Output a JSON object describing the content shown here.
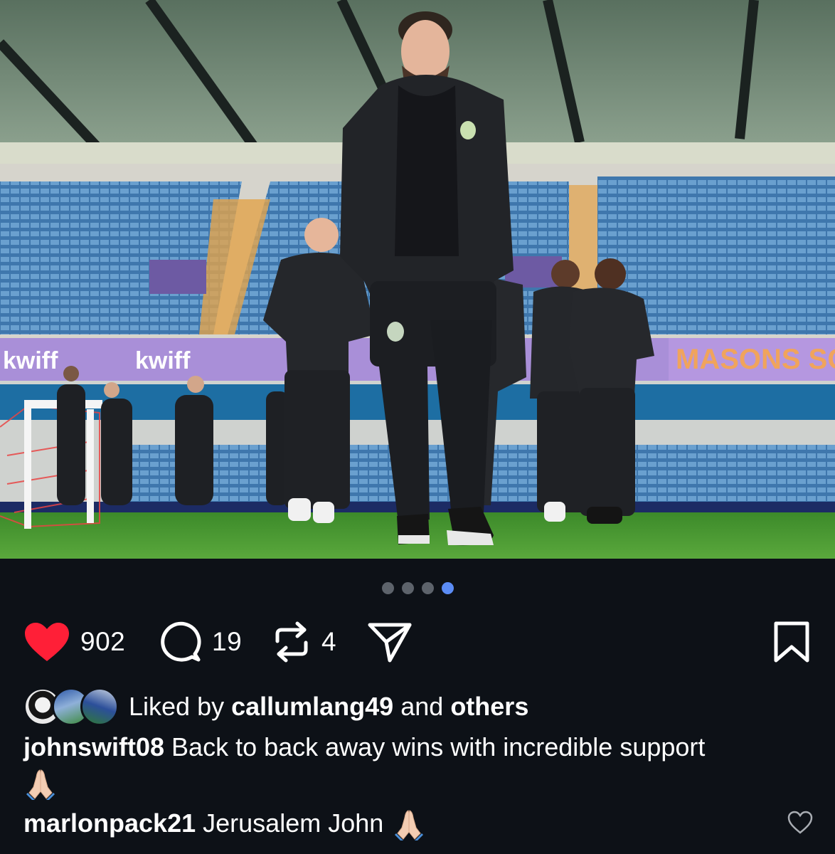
{
  "post": {
    "carousel": {
      "total": 4,
      "active_index": 3
    },
    "actions": {
      "likes_count": "902",
      "comments_count": "19",
      "reposts_count": "4",
      "liked": true
    },
    "liked_by": {
      "prefix": "Liked by",
      "user": "callumlang49",
      "conjunction": "and",
      "others": "others"
    },
    "caption": {
      "username": "johnswift08",
      "text": "Back to back away wins with incredible support"
    },
    "top_comment": {
      "username": "marlonpack21",
      "text": "Jerusalem John"
    },
    "photo": {
      "banner_left": "kwiff",
      "banner_left_2": "kwiff",
      "banner_right": "MASONS SO"
    }
  },
  "colors": {
    "background": "#0d1117",
    "like_red": "#ff1f37",
    "dot_active": "#5b8cf5",
    "dot_inactive": "#5d636b"
  },
  "icons": {
    "like": "heart-filled-icon",
    "comment": "comment-bubble-icon",
    "repost": "repost-arrows-icon",
    "share": "paper-plane-icon",
    "save": "bookmark-icon",
    "comment_like": "heart-outline-icon",
    "emoji": "folded-hands-emoji"
  }
}
